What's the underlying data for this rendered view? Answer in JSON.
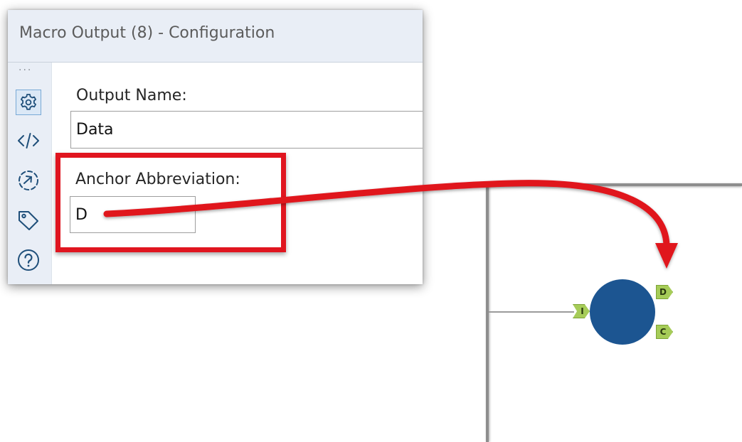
{
  "config_panel": {
    "title": "Macro Output (8) - Configuration",
    "rail_dots": "···",
    "rail_icons": [
      "gear-icon",
      "code-icon",
      "circle-arrow-icon",
      "tag-icon",
      "help-icon"
    ],
    "output_name": {
      "label": "Output Name:",
      "value": "Data"
    },
    "anchor_abbreviation": {
      "label": "Anchor Abbreviation:",
      "value": "D"
    }
  },
  "canvas": {
    "tool": {
      "color": "#1c5591",
      "input_anchor": "I",
      "output_anchors": [
        "D",
        "C"
      ]
    }
  },
  "annotation": {
    "color": "#e0151f"
  }
}
